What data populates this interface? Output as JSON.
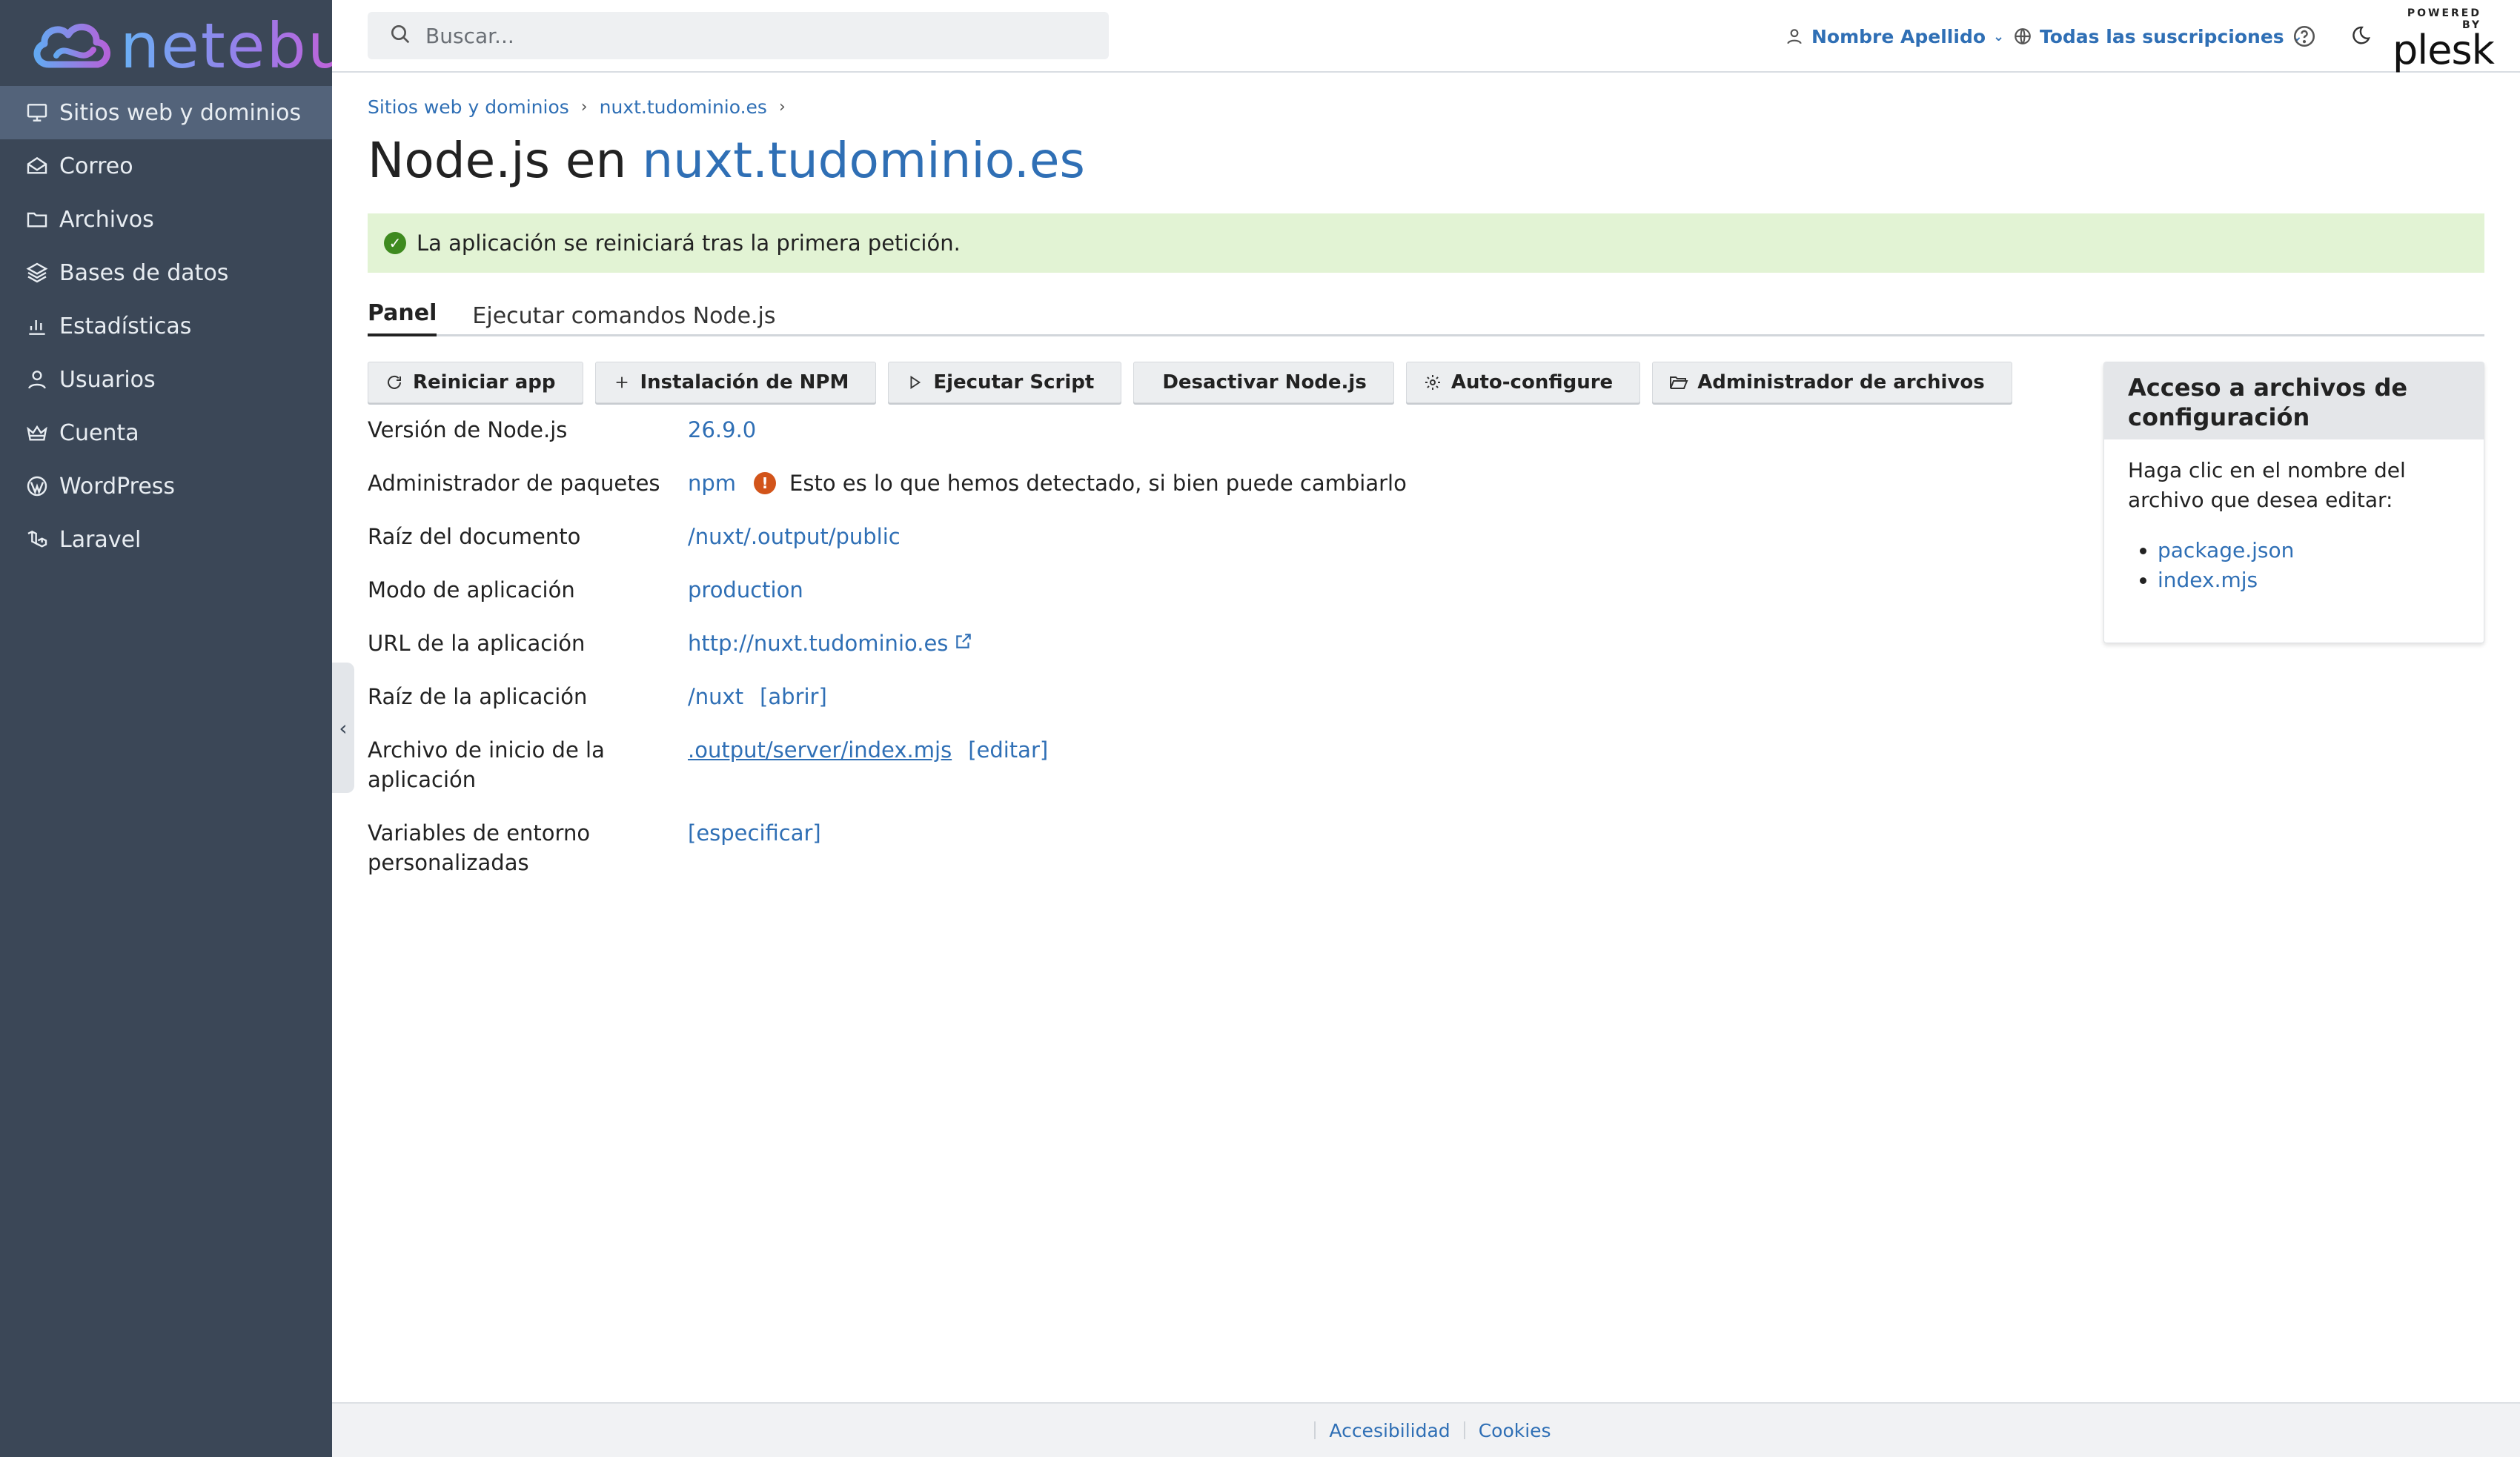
{
  "brand": {
    "name": "netebu"
  },
  "sidebar": {
    "items": [
      {
        "label": "Sitios web y dominios",
        "icon": "monitor-icon",
        "active": true
      },
      {
        "label": "Correo",
        "icon": "mail-icon"
      },
      {
        "label": "Archivos",
        "icon": "folder-icon"
      },
      {
        "label": "Bases de datos",
        "icon": "database-icon"
      },
      {
        "label": "Estadísticas",
        "icon": "bar-chart-icon"
      },
      {
        "label": "Usuarios",
        "icon": "user-icon"
      },
      {
        "label": "Cuenta",
        "icon": "crown-icon"
      },
      {
        "label": "WordPress",
        "icon": "wordpress-icon"
      },
      {
        "label": "Laravel",
        "icon": "laravel-icon"
      }
    ]
  },
  "header": {
    "search_placeholder": "Buscar...",
    "user_name": "Nombre Apellido",
    "subscriptions": "Todas las suscripciones",
    "powered_by": "POWERED BY",
    "plesk": "plesk"
  },
  "breadcrumb": [
    "Sitios web y dominios",
    "nuxt.tudominio.es"
  ],
  "title": {
    "prefix": "Node.js en",
    "domain": "nuxt.tudominio.es"
  },
  "alert": {
    "message": "La aplicación se reiniciará tras la primera petición.",
    "color": "#e2f3d4"
  },
  "tabs": [
    {
      "label": "Panel",
      "active": true
    },
    {
      "label": "Ejecutar comandos Node.js"
    }
  ],
  "toolbar": {
    "restart": "Reiniciar app",
    "npm_install": "Instalación de NPM",
    "run_script": "Ejecutar Script",
    "disable": "Desactivar Node.js",
    "autoconfigure": "Auto-configure",
    "file_manager": "Administrador de archivos"
  },
  "properties": {
    "node_version": {
      "label": "Versión de Node.js",
      "value": "26.9.0"
    },
    "package_manager": {
      "label": "Administrador de paquetes",
      "value": "npm",
      "note": "Esto es lo que hemos detectado, si bien puede cambiarlo"
    },
    "document_root": {
      "label": "Raíz del documento",
      "value": "/nuxt/.output/public"
    },
    "app_mode": {
      "label": "Modo de aplicación",
      "value": "production"
    },
    "app_url": {
      "label": "URL de la aplicación",
      "value": "http://nuxt.tudominio.es"
    },
    "app_root": {
      "label": "Raíz de la aplicación",
      "value": "/nuxt",
      "action": "[abrir]"
    },
    "startup_file": {
      "label": "Archivo de inicio de la aplicación",
      "value": ".output/server/index.mjs",
      "action": "[editar]"
    },
    "env_vars": {
      "label": "Variables de entorno personalizadas",
      "action": "[especificar]"
    }
  },
  "config_panel": {
    "title": "Acceso a archivos de configuración",
    "description": "Haga clic en el nombre del archivo que desea editar:",
    "files": [
      "package.json",
      "index.mjs"
    ]
  },
  "footer": {
    "accessibility": "Accesibilidad",
    "cookies": "Cookies"
  },
  "colors": {
    "sidebar": "#3b4757",
    "link": "#2f6fb5",
    "success": "#3e8a1f",
    "warning": "#d2541a"
  }
}
